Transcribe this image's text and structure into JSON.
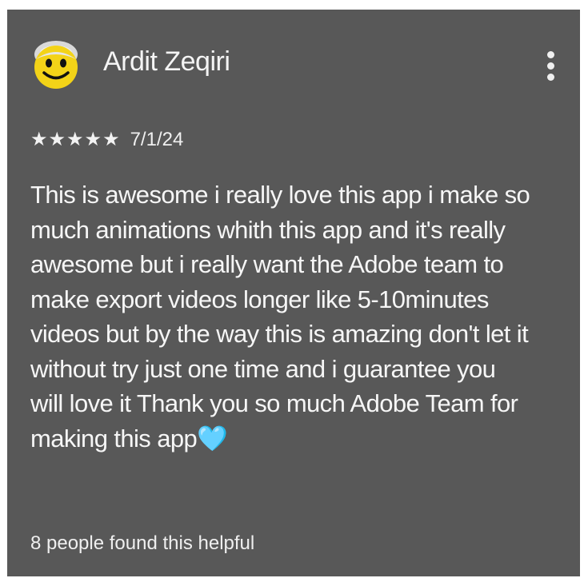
{
  "review": {
    "author": "Ardit Zeqiri",
    "rating_stars": "★★★★★",
    "rating": 5,
    "date": "7/1/24",
    "text": "This is awesome i really love this app i make so\nmuch animations whith this app and it's really\nawesome but i really want the Adobe team to\nmake export videos longer like 5-10minutes\nvideos but by the way this is amazing don't let it\nwithout try just one time and i guarantee you\nwill love it Thank you so much Adobe Team for\nmaking this app",
    "emoji": "🩵",
    "helpful_text": "8 people found this helpful",
    "avatar_icon": "smiley-face-icon",
    "menu_icon": "more-vert-icon"
  },
  "colors": {
    "card_background": "#585858",
    "text": "#f6f6f6",
    "heart": "#68d5ef"
  }
}
